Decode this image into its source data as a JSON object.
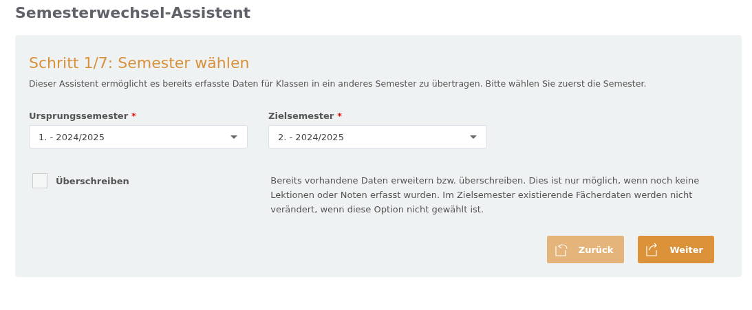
{
  "page_title": "Semesterwechsel-Assistent",
  "step": {
    "title": "Schritt 1/7: Semester wählen",
    "description": "Dieser Assistent ermöglicht es bereits erfasste Daten für Klassen in ein anderes Semester zu übertragen. Bitte wählen Sie zuerst die Semester."
  },
  "fields": [
    {
      "label": "Ursprungssemester",
      "required_mark": "*",
      "value": "1. - 2024/2025"
    },
    {
      "label": "Zielsemester",
      "required_mark": "*",
      "value": "2. - 2024/2025"
    }
  ],
  "overwrite": {
    "label": "Überschreiben",
    "checked": false,
    "help": "Bereits vorhandene Daten erweitern bzw. überschreiben. Dies ist nur möglich, wenn noch keine Lektionen oder Noten erfasst wurden. Im Zielsemester existierende Fächerdaten werden nicht verändert, wenn diese Option nicht gewählt ist."
  },
  "buttons": [
    {
      "label": "Zurück",
      "kind": "back",
      "disabled": true
    },
    {
      "label": "Weiter",
      "kind": "next",
      "disabled": false
    }
  ]
}
